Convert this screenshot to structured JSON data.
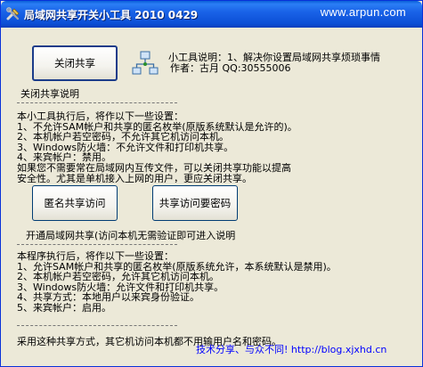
{
  "window": {
    "title": "局域网共享开关小工具 2010 0429",
    "watermark": "www.arpun.com"
  },
  "header": {
    "close_share_button": "关闭共享",
    "info_line1": "小工具说明：1、解决你设置局域网共享烦琐事情",
    "info_line2": "作者：古月 QQ:30555006"
  },
  "section1": {
    "title": "关闭共享说明",
    "lines": [
      "本小工具执行后，将作以下一些设置：",
      "1、不允许SAM帐户和共享的匿名枚举(原版系统默认是允许的)。",
      "2、本机帐户若空密码，不允许其它机访问本机。",
      "3、Windows防火墙：不允许文件和打印机共享。",
      "4、来宾帐户：禁用。",
      " 如果您不需要常在局域网内互传文件，可以关闭共享功能以提高",
      "安全性。尤其是单机接入上网的用户，更应关闭共享。"
    ]
  },
  "buttons": {
    "anonymous_access": "匿名共享访问",
    "password_access": "共享访问要密码"
  },
  "section2": {
    "title": "开通局域网共享(访问本机无需验证即可进入说明",
    "lines": [
      "本程序执行后，将作以下一些设置：",
      "1、允许SAM帐户和共享的匿名枚举(原版系统允许，本系统默认是禁用)。",
      "2、本机帐户若空密码，允许其它机访问本机。",
      "3、Windows防火墙：允许文件和打印机共享。",
      "4、共享方式：本地用户以来宾身份验证。",
      "5、来宾帐户：启用。"
    ],
    "note": "采用这种共享方式，其它机访问本机都不用输用户名和密码。"
  },
  "footer": {
    "link": "技术分享、与众不同!  http://blog.xjxhd.cn"
  }
}
